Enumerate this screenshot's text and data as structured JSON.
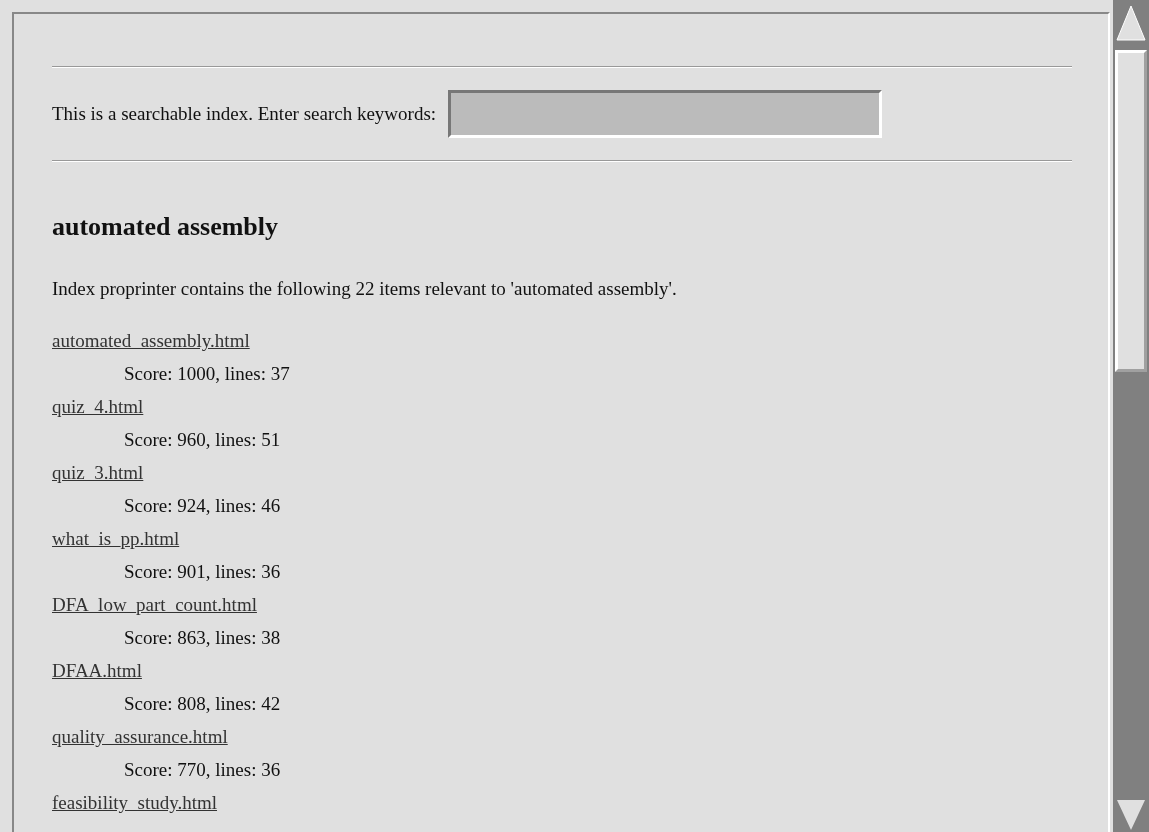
{
  "search": {
    "label": "This is a searchable index. Enter search keywords:"
  },
  "heading": "automated assembly",
  "summary": "Index proprinter contains the following 22 items relevant to 'automated assembly'.",
  "results": [
    {
      "file": "automated_assembly.html",
      "details": "Score: 1000, lines: 37"
    },
    {
      "file": "quiz_4.html",
      "details": "Score: 960, lines: 51"
    },
    {
      "file": "quiz_3.html",
      "details": "Score: 924, lines: 46"
    },
    {
      "file": "what_is_pp.html",
      "details": "Score: 901, lines: 36"
    },
    {
      "file": "DFA_low_part_count.html",
      "details": "Score: 863, lines: 38"
    },
    {
      "file": "DFAA.html",
      "details": "Score: 808, lines: 42"
    },
    {
      "file": "quality_assurance.html",
      "details": "Score: 770, lines: 36"
    },
    {
      "file": "feasibility_study.html"
    }
  ]
}
